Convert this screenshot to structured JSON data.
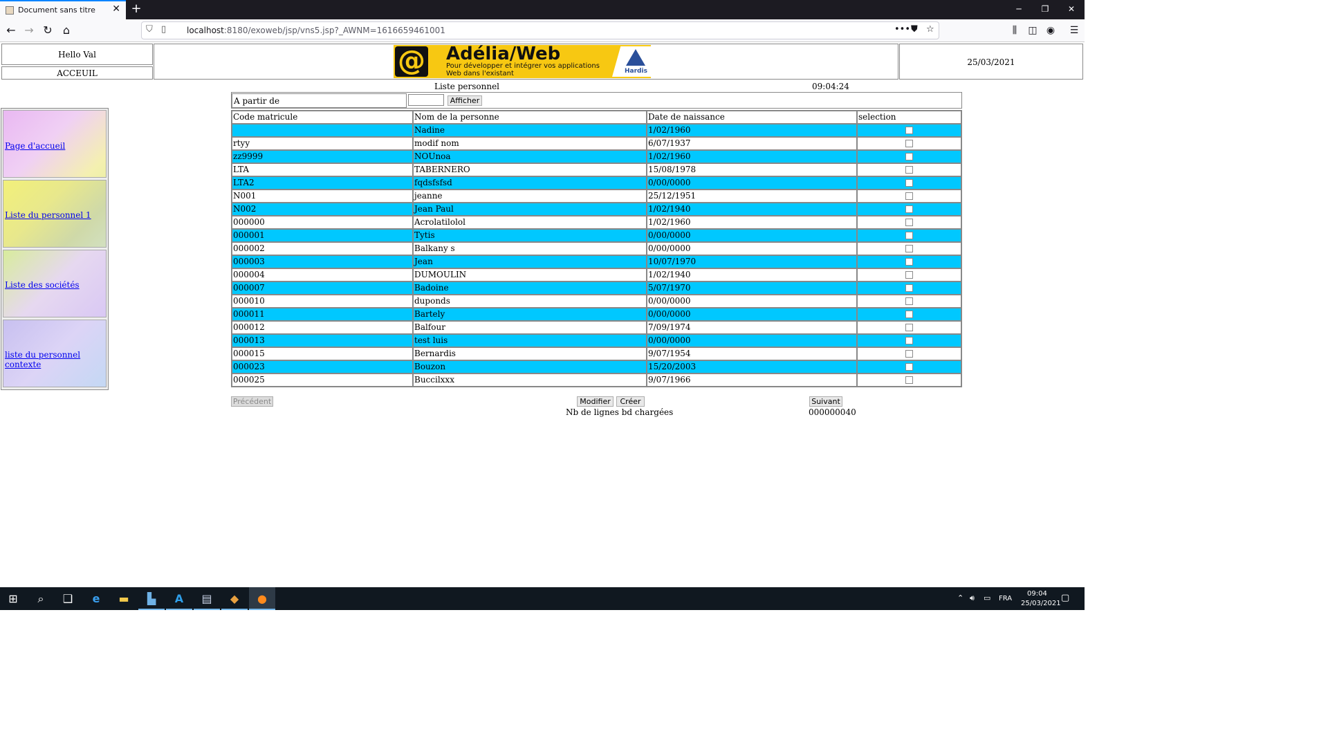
{
  "browser": {
    "tab_title": "Document sans titre",
    "url_host": "localhost",
    "url_rest": ":8180/exoweb/jsp/vns5.jsp?_AWNM=1616659461001"
  },
  "header": {
    "greeting": "Hello Val",
    "home_label": "ACCEUIL",
    "logo_brand": "Adélia/Web",
    "logo_tagline_1": "Pour développer et intégrer vos applications",
    "logo_tagline_2": "Web dans l'existant",
    "logo_company": "Hardis",
    "date": "25/03/2021"
  },
  "sidebar": {
    "items": [
      {
        "label": "Page d'accueil"
      },
      {
        "label": "Liste du personnel 1"
      },
      {
        "label": "Liste des sociétés"
      },
      {
        "label": "liste du personnel contexte"
      }
    ]
  },
  "list": {
    "title": "Liste personnel",
    "time": "09:04:24",
    "filter_label": "A partir de",
    "filter_value": "",
    "show_button": "Afficher",
    "columns": [
      "Code matricule",
      "Nom de la personne",
      "Date de naissance",
      "selection"
    ],
    "rows": [
      {
        "code": "",
        "name": "Nadine",
        "birth": "1/02/1960"
      },
      {
        "code": "rtyy",
        "name": "modif nom",
        "birth": "6/07/1937"
      },
      {
        "code": "zz9999",
        "name": "NOUnoa",
        "birth": "1/02/1960"
      },
      {
        "code": "LTA",
        "name": "TABERNERO",
        "birth": "15/08/1978"
      },
      {
        "code": "LTA2",
        "name": "fqdsfsfsd",
        "birth": "0/00/0000"
      },
      {
        "code": "N001",
        "name": "jeanne",
        "birth": "25/12/1951"
      },
      {
        "code": "N002",
        "name": "Jean Paul",
        "birth": "1/02/1940"
      },
      {
        "code": "000000",
        "name": "Acrolatilolol",
        "birth": "1/02/1960"
      },
      {
        "code": "000001",
        "name": "Tytis",
        "birth": "0/00/0000"
      },
      {
        "code": "000002",
        "name": "Balkany s",
        "birth": "0/00/0000"
      },
      {
        "code": "000003",
        "name": "Jean",
        "birth": "10/07/1970"
      },
      {
        "code": "000004",
        "name": "DUMOULIN",
        "birth": "1/02/1940"
      },
      {
        "code": "000007",
        "name": "Badoine",
        "birth": "5/07/1970"
      },
      {
        "code": "000010",
        "name": "duponds",
        "birth": "0/00/0000"
      },
      {
        "code": "000011",
        "name": "Bartely",
        "birth": "0/00/0000"
      },
      {
        "code": "000012",
        "name": "Balfour",
        "birth": "7/09/1974"
      },
      {
        "code": "000013",
        "name": "test luis",
        "birth": "0/00/0000"
      },
      {
        "code": "000015",
        "name": "Bernardis",
        "birth": "9/07/1954"
      },
      {
        "code": "000023",
        "name": "Bouzon",
        "birth": "15/20/2003"
      },
      {
        "code": "000025",
        "name": "Buccilxxx",
        "birth": "9/07/1966"
      }
    ],
    "prev_button": "Précédent",
    "modify_button": "Modifier",
    "create_button": "Créer",
    "next_button": "Suivant",
    "count_label": "Nb de lignes bd chargées",
    "count_value": "000000040"
  },
  "taskbar": {
    "lang": "FRA",
    "clock_time": "09:04",
    "clock_date": "25/03/2021"
  }
}
